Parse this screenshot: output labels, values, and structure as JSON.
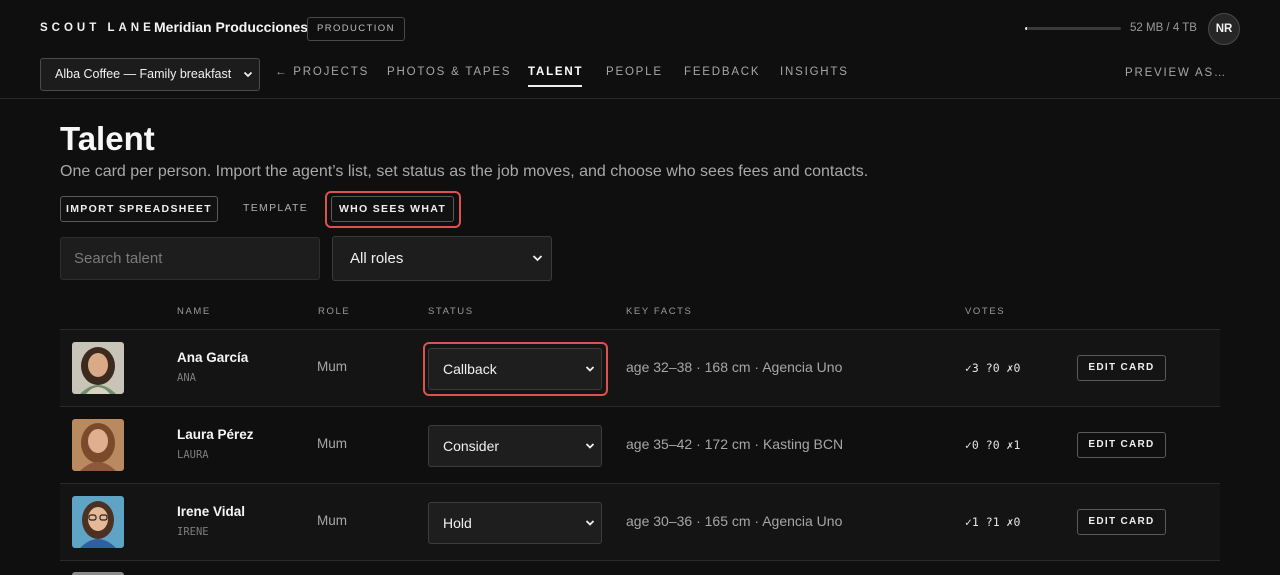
{
  "brand": "SCOUT LANE",
  "organization": "Meridian Producciones",
  "phase_badge": "PRODUCTION",
  "storage": {
    "used_fraction": 0.02,
    "label": "52 MB / 4 TB"
  },
  "user_initials": "NR",
  "project_select": {
    "value": "Alba Coffee — Family breakfast"
  },
  "nav": {
    "back_projects": "← PROJECTS",
    "photos_tapes": "PHOTOS & TAPES",
    "talent": "TALENT",
    "people": "PEOPLE",
    "feedback": "FEEDBACK",
    "insights": "INSIGHTS",
    "preview_as": "PREVIEW AS…",
    "active": "TALENT"
  },
  "page": {
    "title": "Talent",
    "subtitle": "One card per person. Import the agent’s list, set status as the job moves, and choose who sees fees and contacts."
  },
  "actions": {
    "import": "IMPORT SPREADSHEET",
    "template": "TEMPLATE",
    "who_sees_what": "WHO SEES WHAT"
  },
  "filters": {
    "search_placeholder": "Search talent",
    "role_value": "All roles"
  },
  "table": {
    "headers": {
      "name": "NAME",
      "role": "ROLE",
      "status": "STATUS",
      "key_facts": "KEY FACTS",
      "votes": "VOTES"
    },
    "edit_label": "EDIT CARD",
    "rows": [
      {
        "name": "Ana García",
        "handle": "ANA",
        "role": "Mum",
        "status": "Callback",
        "facts": "age 32–38 · 168 cm · Agencia Uno",
        "votes": "✓3 ?0 ✗0"
      },
      {
        "name": "Laura Pérez",
        "handle": "LAURA",
        "role": "Mum",
        "status": "Consider",
        "facts": "age 35–42 · 172 cm · Kasting BCN",
        "votes": "✓0 ?0 ✗1"
      },
      {
        "name": "Irene Vidal",
        "handle": "IRENE",
        "role": "Mum",
        "status": "Hold",
        "facts": "age 30–36 · 165 cm · Agencia Uno",
        "votes": "✓1 ?1 ✗0"
      }
    ]
  }
}
